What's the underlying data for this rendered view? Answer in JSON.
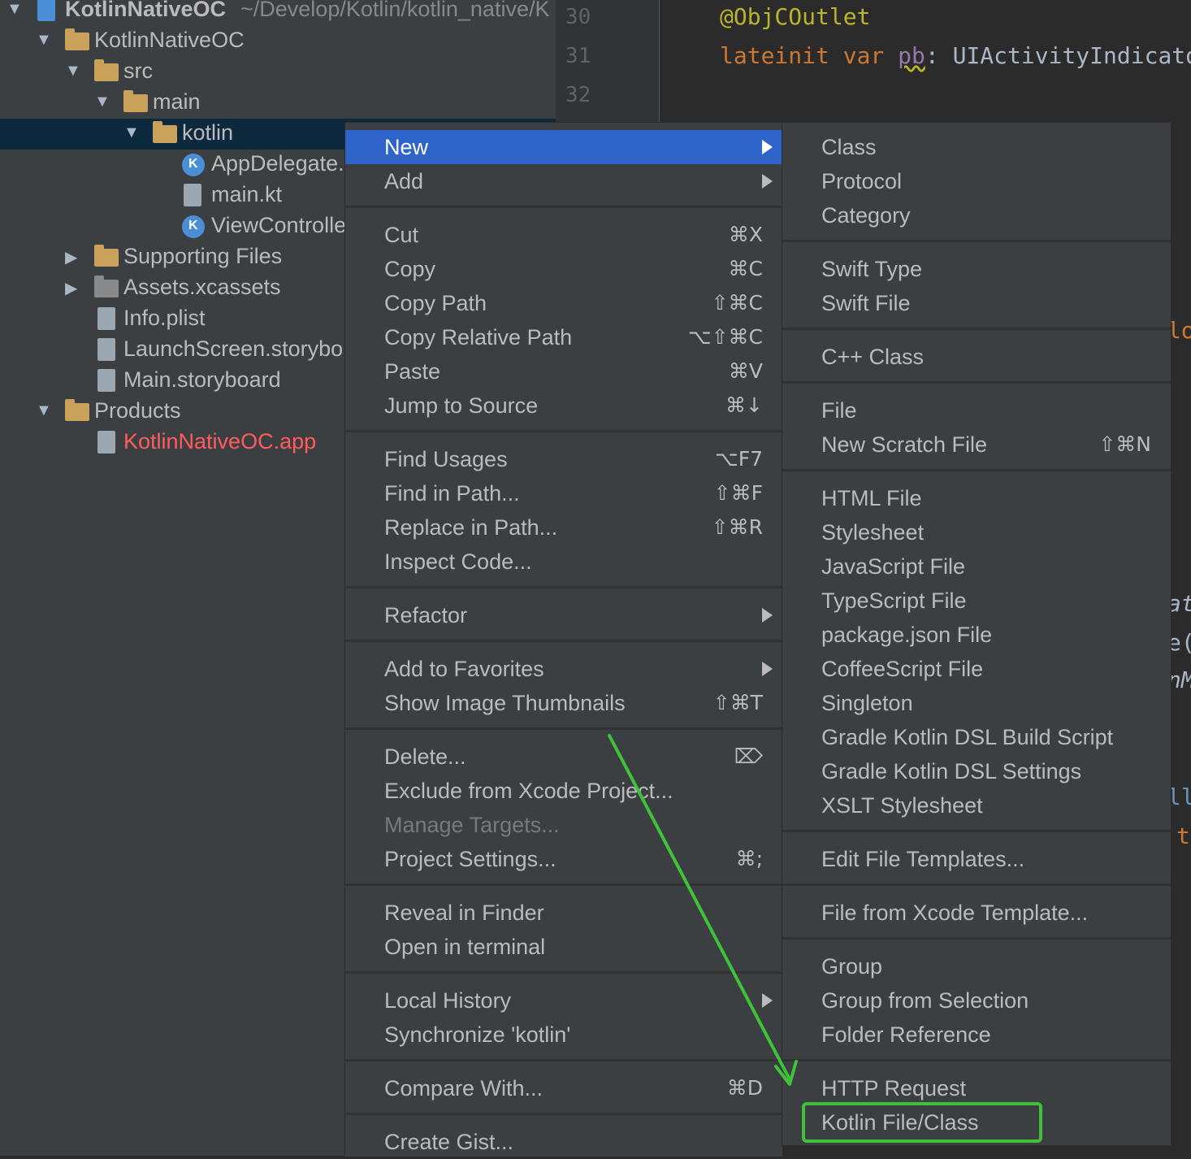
{
  "project_tree": {
    "root": {
      "name": "KotlinNativeOC",
      "path": "~/Develop/Kotlin/kotlin_native/K"
    },
    "items": [
      {
        "label": "KotlinNativeOC",
        "icon": "folder-icon"
      },
      {
        "label": "src",
        "icon": "folder-icon"
      },
      {
        "label": "main",
        "icon": "folder-icon"
      },
      {
        "label": "kotlin",
        "icon": "folder-icon"
      },
      {
        "label": "AppDelegate.",
        "icon": "kotlin-class-icon"
      },
      {
        "label": "main.kt",
        "icon": "kotlin-file-icon"
      },
      {
        "label": "ViewControlle",
        "icon": "kotlin-class-icon"
      },
      {
        "label": "Supporting Files",
        "icon": "folder-icon"
      },
      {
        "label": "Assets.xcassets",
        "icon": "asset-folder-icon"
      },
      {
        "label": "Info.plist",
        "icon": "plist-icon"
      },
      {
        "label": "LaunchScreen.storybo",
        "icon": "storyboard-icon"
      },
      {
        "label": "Main.storyboard",
        "icon": "storyboard-icon"
      },
      {
        "label": "Products",
        "icon": "folder-icon"
      },
      {
        "label": "KotlinNativeOC.app",
        "icon": "app-icon",
        "color": "#ff5c5c"
      }
    ]
  },
  "editor": {
    "line_numbers": [
      "30",
      "31",
      "32"
    ],
    "line1": "@ObjCOutlet",
    "line2_kw": "lateinit var ",
    "line2_name": "pb",
    "line2_rest": ": UIActivityIndicatorV",
    "fragments": [
      "lo",
      "at",
      "e(",
      "nM",
      "ll",
      "t"
    ]
  },
  "context_menu": {
    "items": [
      {
        "label": "New",
        "submenu": true,
        "active": true
      },
      {
        "label": "Add",
        "submenu": true
      },
      {
        "label": "Cut",
        "shortcut": "⌘X"
      },
      {
        "label": "Copy",
        "shortcut": "⌘C"
      },
      {
        "label": "Copy Path",
        "shortcut": "⇧⌘C"
      },
      {
        "label": "Copy Relative Path",
        "shortcut": "⌥⇧⌘C"
      },
      {
        "label": "Paste",
        "shortcut": "⌘V"
      },
      {
        "label": "Jump to Source",
        "shortcut": "⌘↓"
      },
      {
        "label": "Find Usages",
        "shortcut": "⌥F7"
      },
      {
        "label": "Find in Path...",
        "shortcut": "⇧⌘F"
      },
      {
        "label": "Replace in Path...",
        "shortcut": "⇧⌘R"
      },
      {
        "label": "Inspect Code..."
      },
      {
        "label": "Refactor",
        "submenu": true
      },
      {
        "label": "Add to Favorites",
        "submenu": true
      },
      {
        "label": "Show Image Thumbnails",
        "shortcut": "⇧⌘T"
      },
      {
        "label": "Delete...",
        "shortcut": "⌦"
      },
      {
        "label": "Exclude from Xcode Project..."
      },
      {
        "label": "Manage Targets...",
        "disabled": true
      },
      {
        "label": "Project Settings...",
        "shortcut": "⌘;"
      },
      {
        "label": "Reveal in Finder"
      },
      {
        "label": "Open in terminal"
      },
      {
        "label": "Local History",
        "submenu": true
      },
      {
        "label": "Synchronize 'kotlin'"
      },
      {
        "label": "Compare With...",
        "shortcut": "⌘D"
      },
      {
        "label": "Create Gist..."
      }
    ]
  },
  "new_submenu": {
    "items": [
      {
        "label": "Class"
      },
      {
        "label": "Protocol"
      },
      {
        "label": "Category"
      },
      {
        "label": "Swift Type"
      },
      {
        "label": "Swift File"
      },
      {
        "label": "C++ Class"
      },
      {
        "label": "File"
      },
      {
        "label": "New Scratch File",
        "shortcut": "⇧⌘N"
      },
      {
        "label": "HTML File"
      },
      {
        "label": "Stylesheet"
      },
      {
        "label": "JavaScript File"
      },
      {
        "label": "TypeScript File"
      },
      {
        "label": "package.json File"
      },
      {
        "label": "CoffeeScript File"
      },
      {
        "label": "Singleton"
      },
      {
        "label": "Gradle Kotlin DSL Build Script"
      },
      {
        "label": "Gradle Kotlin DSL Settings"
      },
      {
        "label": "XSLT Stylesheet"
      },
      {
        "label": "Edit File Templates..."
      },
      {
        "label": "File from Xcode Template..."
      },
      {
        "label": "Group"
      },
      {
        "label": "Group from Selection"
      },
      {
        "label": "Folder Reference"
      },
      {
        "label": "HTTP Request"
      },
      {
        "label": "Kotlin File/Class",
        "highlighted": true
      }
    ]
  },
  "colors": {
    "accent": "#2f65ca",
    "highlight_box": "#3fc23a",
    "annotation_arrow": "#3fc23a",
    "keyword": "#cc7832",
    "annotation": "#bbb529"
  }
}
